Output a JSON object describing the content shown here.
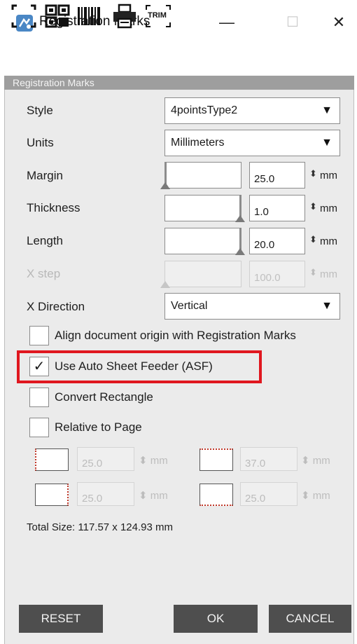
{
  "window": {
    "title": "Registration Marks",
    "controls": {
      "minimize": "—",
      "maximize": "☐",
      "close": "✕"
    }
  },
  "toolbar": {
    "tools": [
      "registration-marks-tool",
      "qr-code-tool",
      "barcode-tool",
      "printer-tool",
      "trim-tool"
    ],
    "trim_label": "TRIM"
  },
  "section": {
    "header": "Registration Marks"
  },
  "form": {
    "style": {
      "label": "Style",
      "value": "4pointsType2"
    },
    "units": {
      "label": "Units",
      "value": "Millimeters"
    },
    "margin": {
      "label": "Margin",
      "value": "25.0",
      "unit": "mm",
      "slider_level": 0.0
    },
    "thickness": {
      "label": "Thickness",
      "value": "1.0",
      "unit": "mm",
      "slider_level": 1.0
    },
    "length": {
      "label": "Length",
      "value": "20.0",
      "unit": "mm",
      "slider_level": 1.0
    },
    "xstep": {
      "label": "X step",
      "value": "100.0",
      "unit": "mm",
      "slider_level": 0.0,
      "disabled": true
    },
    "xdirection": {
      "label": "X Direction",
      "value": "Vertical"
    }
  },
  "checkboxes": {
    "align_origin": {
      "label": "Align document origin with Registration Marks",
      "checked": false
    },
    "asf": {
      "label": "Use Auto Sheet Feeder (ASF)",
      "checked": true,
      "mark": "✓"
    },
    "convert_rect": {
      "label": "Convert Rectangle",
      "checked": false
    },
    "relative_page": {
      "label": "Relative to Page",
      "checked": false
    }
  },
  "offsets": {
    "left": {
      "value": "25.0",
      "unit": "mm"
    },
    "top": {
      "value": "37.0",
      "unit": "mm"
    },
    "bottom": {
      "value": "25.0",
      "unit": "mm"
    },
    "right": {
      "value": "25.0",
      "unit": "mm"
    }
  },
  "total_size": "Total Size: 117.57 x 124.93 mm",
  "buttons": {
    "reset": "RESET",
    "ok": "OK",
    "cancel": "CANCEL"
  },
  "colors": {
    "highlight": "#e0171f",
    "section_header": "#9e9e9e",
    "dark_button": "#4e4e4e"
  }
}
